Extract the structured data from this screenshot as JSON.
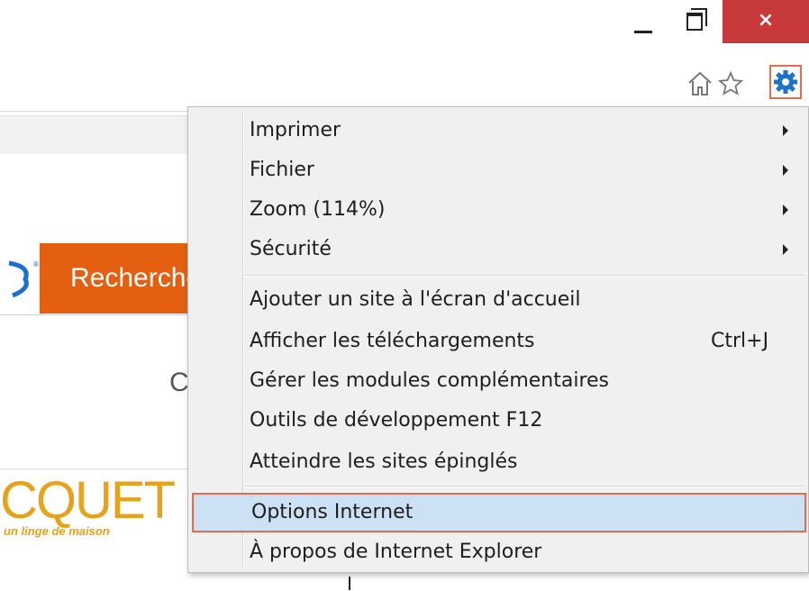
{
  "window": {
    "close_glyph": "×"
  },
  "toolbar": {
    "icons": [
      "home-icon",
      "star-icon",
      "gear-icon"
    ]
  },
  "page": {
    "search_button": "Recherche",
    "partial_letter": "C",
    "logo_text": "CQUET",
    "logo_sub": "un linge de maison"
  },
  "menu": {
    "items": [
      {
        "label": "Imprimer",
        "submenu": true
      },
      {
        "label": "Fichier",
        "submenu": true
      },
      {
        "label": "Zoom (114%)",
        "submenu": true
      },
      {
        "label": "Sécurité",
        "submenu": true
      },
      {
        "label": "Ajouter un site à l'écran d'accueil"
      },
      {
        "label": "Afficher les téléchargements",
        "shortcut": "Ctrl+J"
      },
      {
        "label": "Gérer les modules complémentaires"
      },
      {
        "label": "Outils de développement F12"
      },
      {
        "label": "Atteindre les sites épinglés"
      },
      {
        "label": "Options Internet",
        "highlighted": true
      },
      {
        "label": "À propos de Internet Explorer"
      }
    ]
  },
  "colors": {
    "close_button": "#c7393a",
    "highlight_fill": "#cde1f5",
    "highlight_border": "#e36d4c",
    "search_button": "#e45f10",
    "logo": "#e7a21c",
    "gear": "#1e73c8"
  }
}
